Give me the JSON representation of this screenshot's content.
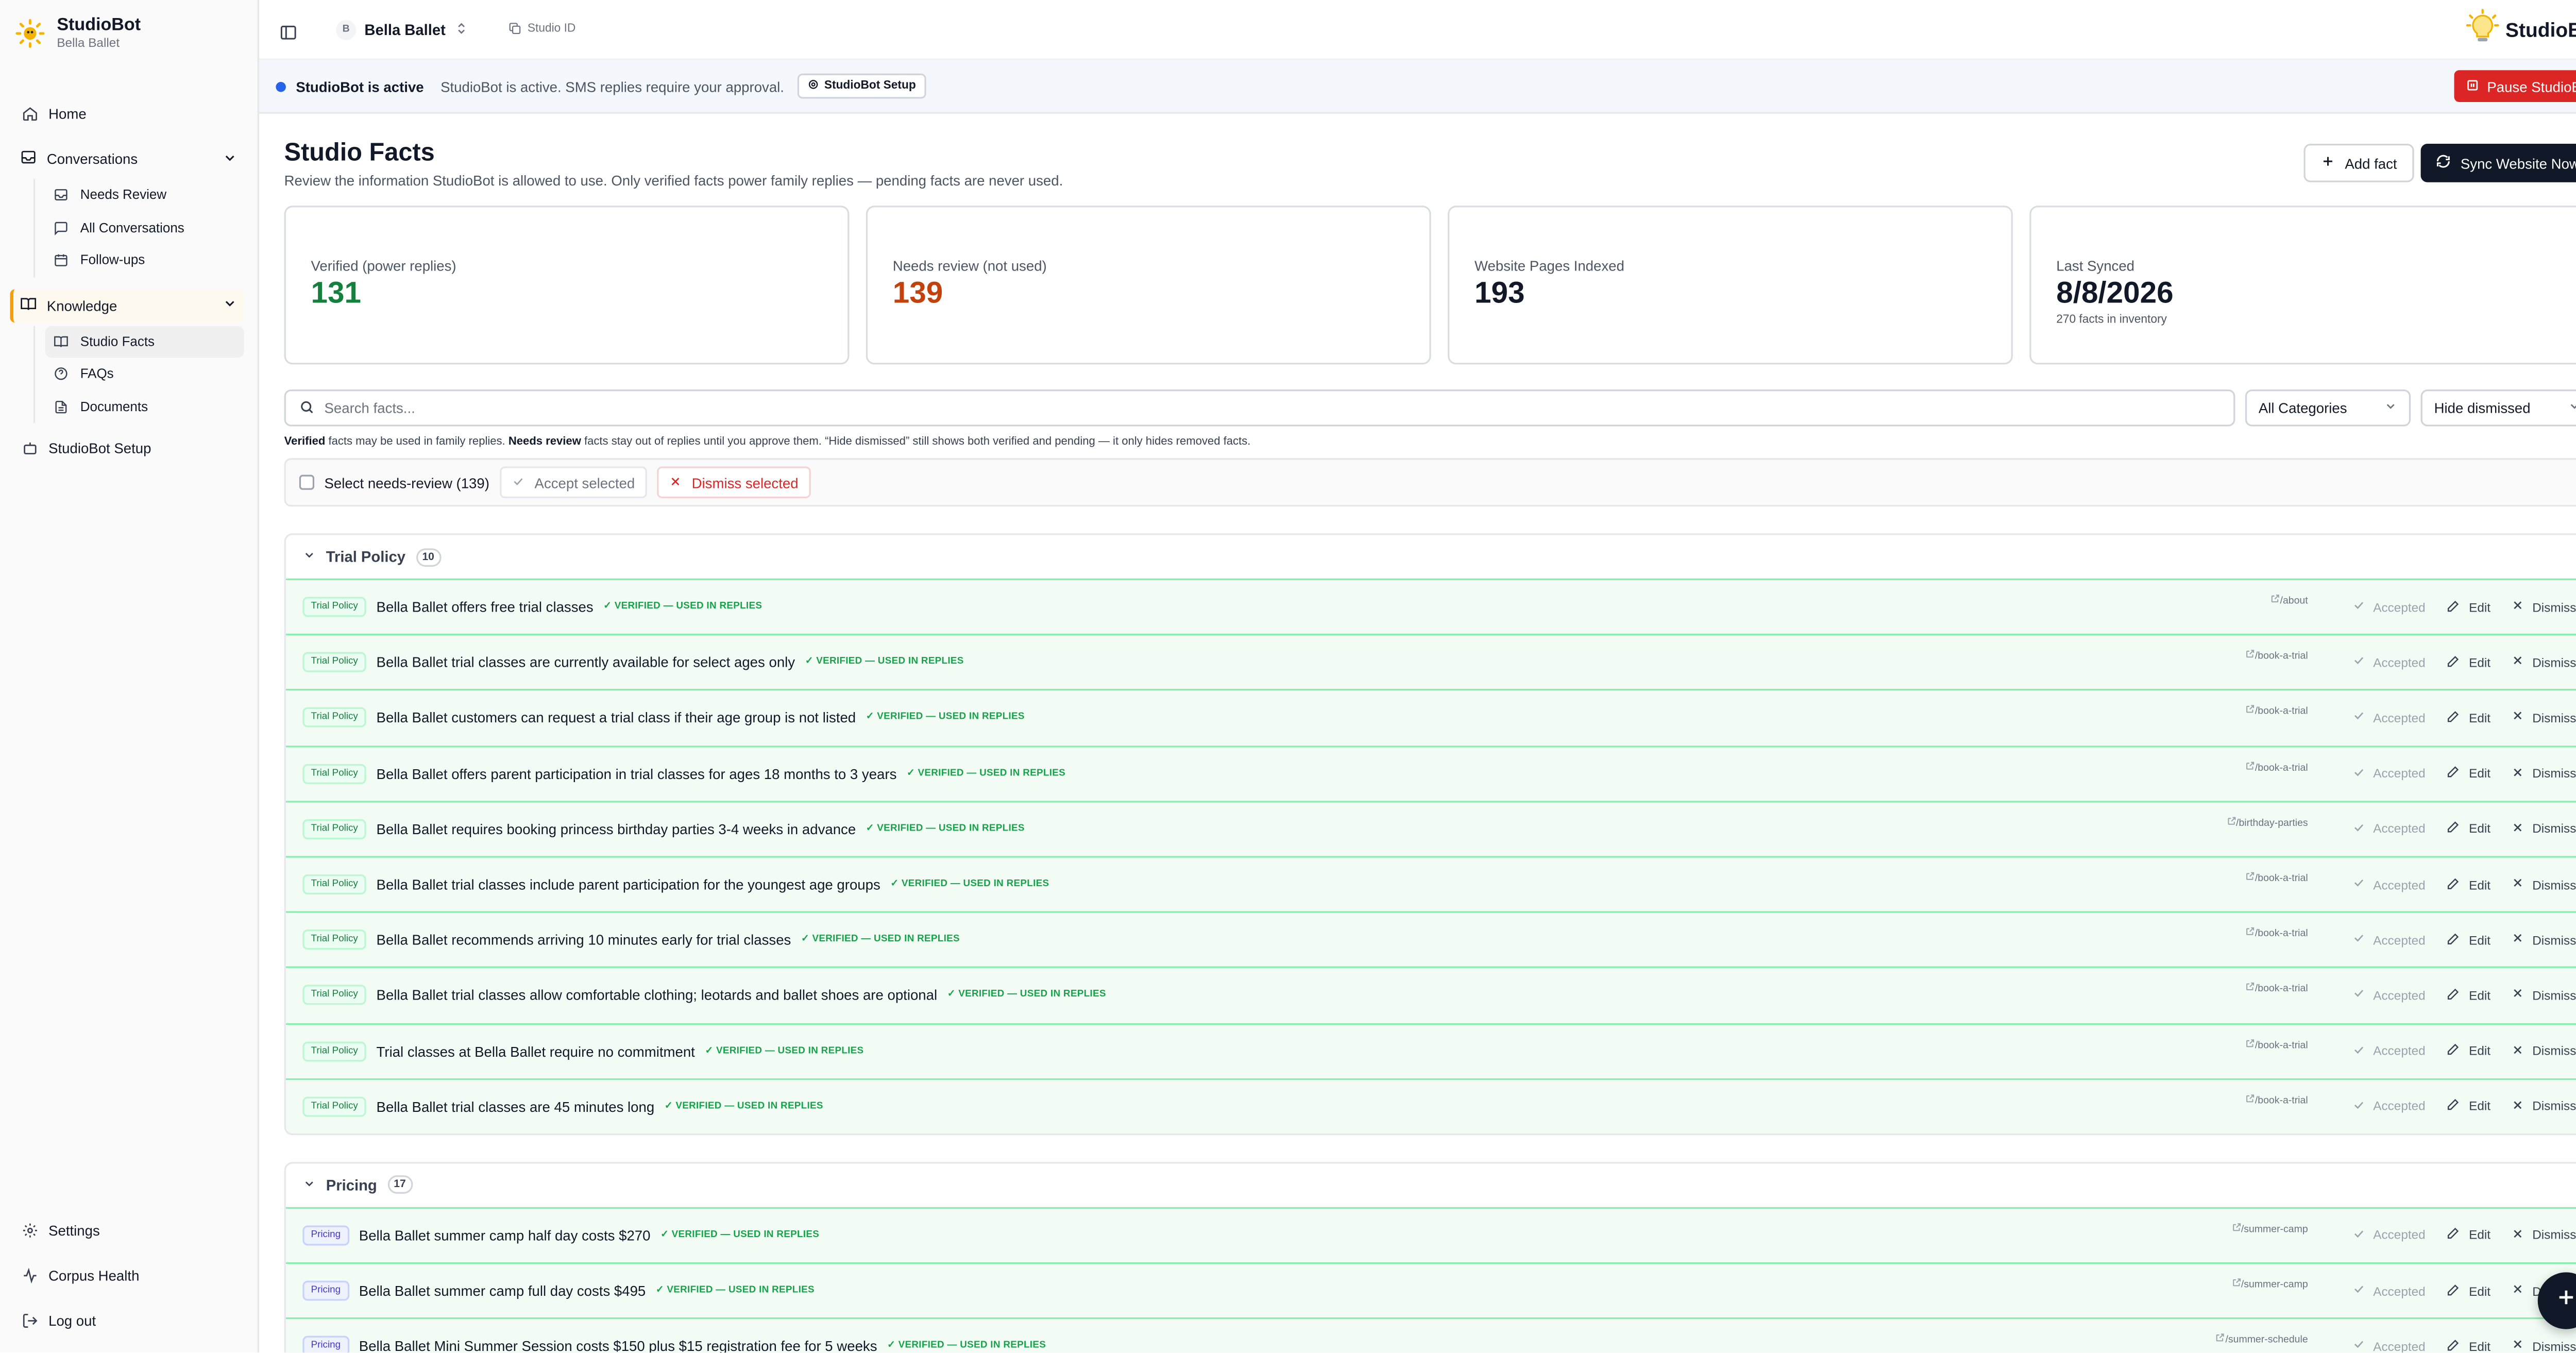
{
  "brand": {
    "name": "StudioBot",
    "studio": "Bella Ballet",
    "logo_icon": "bulb-sun-icon"
  },
  "sidebar": {
    "home": "Home",
    "conversations": {
      "label": "Conversations",
      "items": [
        "Needs Review",
        "All Conversations",
        "Follow-ups"
      ]
    },
    "knowledge": {
      "label": "Knowledge",
      "items": [
        "Studio Facts",
        "FAQs",
        "Documents"
      ]
    },
    "setup": "StudioBot Setup",
    "bottom": [
      "Settings",
      "Corpus Health",
      "Log out"
    ]
  },
  "topbar": {
    "studio_name": "Bella Ballet",
    "studio_initial": "B",
    "studio_id": "Studio ID",
    "logo_text": "StudioBot"
  },
  "banner": {
    "status": "StudioBot is active",
    "message": "StudioBot is active. SMS replies require your approval.",
    "setup_button": "StudioBot Setup",
    "pause_button": "Pause StudioBot"
  },
  "page": {
    "title": "Studio Facts",
    "subtitle": "Review the information StudioBot is allowed to use. Only verified facts power family replies — pending facts are never used.",
    "add_button": "Add fact",
    "sync_button": "Sync Website Now"
  },
  "stats": [
    {
      "label": "Verified (power replies)",
      "value": "131",
      "tone": "green"
    },
    {
      "label": "Needs review (not used)",
      "value": "139",
      "tone": "orange"
    },
    {
      "label": "Website Pages Indexed",
      "value": "193",
      "tone": "default"
    },
    {
      "label": "Last Synced",
      "value": "8/8/2026",
      "tone": "default",
      "small": "270 facts in inventory"
    }
  ],
  "filters": {
    "search_placeholder": "Search facts...",
    "category": "All Categories",
    "dismissed": "Hide dismissed"
  },
  "hint": {
    "verified": "Verified",
    "part1": " facts may be used in family replies. ",
    "needs_review": "Needs review",
    "part2": " facts stay out of replies until you approve them. “Hide dismissed” still shows both verified and pending — it only hides removed facts."
  },
  "bulk": {
    "select_label": "Select needs-review (139)",
    "accept": "Accept selected",
    "dismiss": "Dismiss selected"
  },
  "row_actions": {
    "accepted": "Accepted",
    "edit": "Edit",
    "dismiss": "Dismiss"
  },
  "sections": [
    {
      "name": "Trial Policy",
      "count": "10",
      "tone": "green",
      "rows": [
        {
          "cat": "Trial Policy",
          "fact": "Bella Ballet offers free trial classes",
          "badge": "✓ VERIFIED — USED IN REPLIES",
          "src": "/about"
        },
        {
          "cat": "Trial Policy",
          "fact": "Bella Ballet trial classes are currently available for select ages only",
          "badge": "✓ VERIFIED — USED IN REPLIES",
          "src": "/book-a-trial"
        },
        {
          "cat": "Trial Policy",
          "fact": "Bella Ballet customers can request a trial class if their age group is not listed",
          "badge": "✓ VERIFIED — USED IN REPLIES",
          "src": "/book-a-trial"
        },
        {
          "cat": "Trial Policy",
          "fact": "Bella Ballet offers parent participation in trial classes for ages 18 months to 3 years",
          "badge": "✓ VERIFIED — USED IN REPLIES",
          "src": "/book-a-trial"
        },
        {
          "cat": "Trial Policy",
          "fact": "Bella Ballet requires booking princess birthday parties 3-4 weeks in advance",
          "badge": "✓ VERIFIED — USED IN REPLIES",
          "src": "/birthday-parties"
        },
        {
          "cat": "Trial Policy",
          "fact": "Bella Ballet trial classes include parent participation for the youngest age groups",
          "badge": "✓ VERIFIED — USED IN REPLIES",
          "src": "/book-a-trial"
        },
        {
          "cat": "Trial Policy",
          "fact": "Bella Ballet recommends arriving 10 minutes early for trial classes",
          "badge": "✓ VERIFIED — USED IN REPLIES",
          "src": "/book-a-trial"
        },
        {
          "cat": "Trial Policy",
          "fact": "Bella Ballet trial classes allow comfortable clothing; leotards and ballet shoes are optional",
          "badge": "✓ VERIFIED — USED IN REPLIES",
          "src": "/book-a-trial"
        },
        {
          "cat": "Trial Policy",
          "fact": "Trial classes at Bella Ballet require no commitment",
          "badge": "✓ VERIFIED — USED IN REPLIES",
          "src": "/book-a-trial"
        },
        {
          "cat": "Trial Policy",
          "fact": "Bella Ballet trial classes are 45 minutes long",
          "badge": "✓ VERIFIED — USED IN REPLIES",
          "src": "/book-a-trial"
        }
      ]
    },
    {
      "name": "Pricing",
      "count": "17",
      "tone": "blue",
      "rows": [
        {
          "cat": "Pricing",
          "fact": "Bella Ballet summer camp half day costs $270",
          "badge": "✓ VERIFIED — USED IN REPLIES",
          "src": "/summer-camp"
        },
        {
          "cat": "Pricing",
          "fact": "Bella Ballet summer camp full day costs $495",
          "badge": "✓ VERIFIED — USED IN REPLIES",
          "src": "/summer-camp"
        },
        {
          "cat": "Pricing",
          "fact": "Bella Ballet Mini Summer Session costs $150 plus $15 registration fee for 5 weeks",
          "badge": "✓ VERIFIED — USED IN REPLIES",
          "src": "/summer-schedule"
        }
      ]
    }
  ]
}
